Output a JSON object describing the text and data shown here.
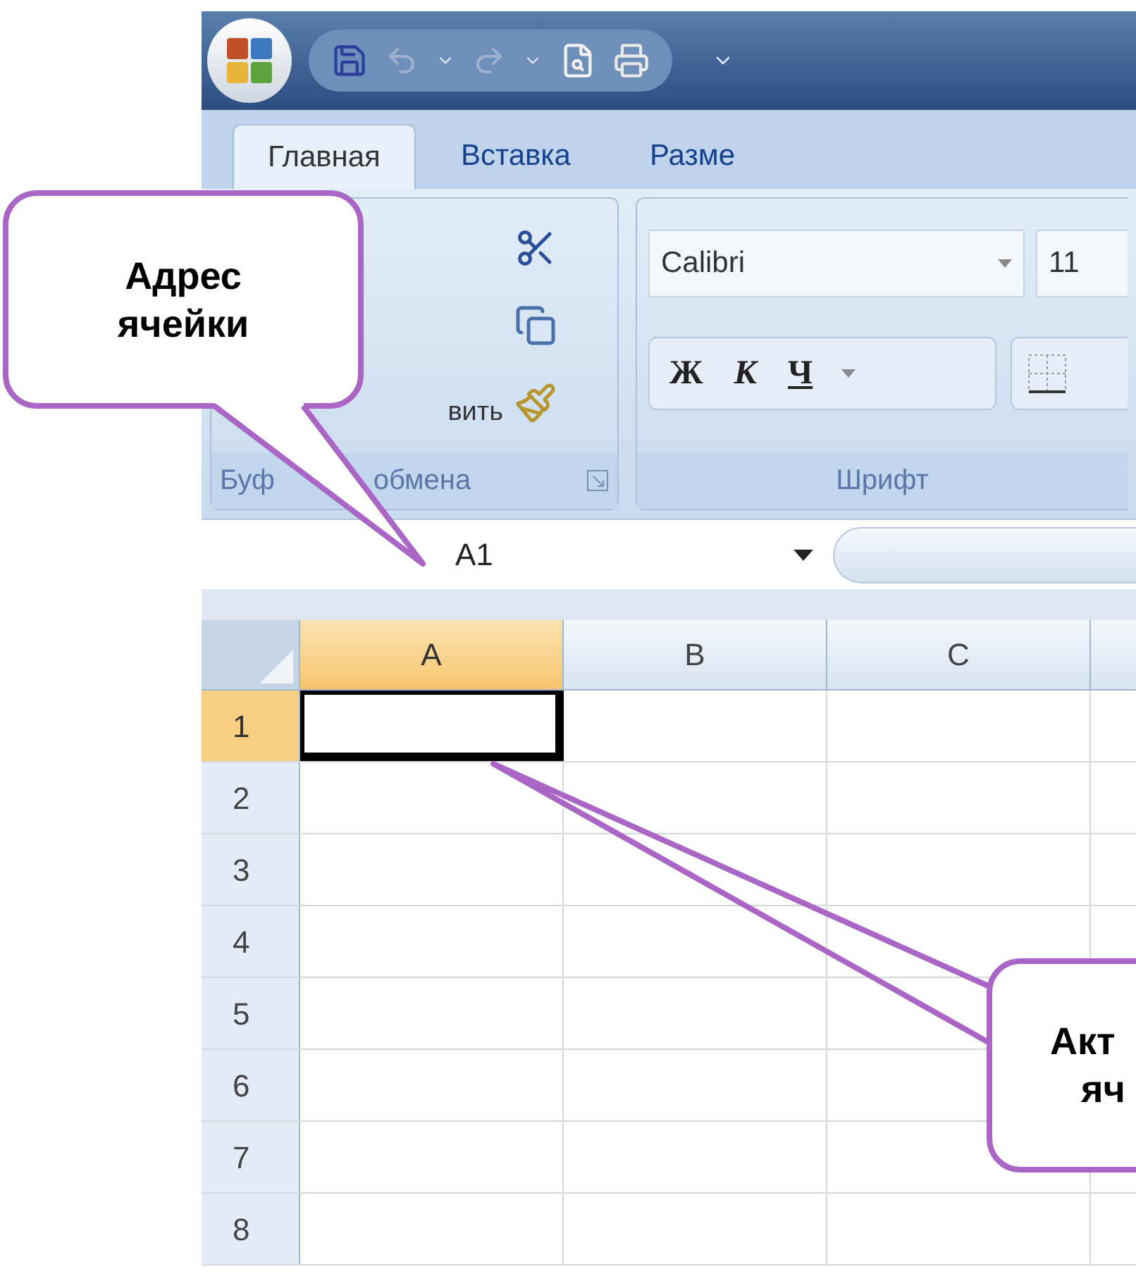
{
  "tabs": [
    {
      "label": "Главная",
      "selected": true
    },
    {
      "label": "Вставка",
      "selected": false
    },
    {
      "label": "Разме",
      "selected": false
    }
  ],
  "ribbon": {
    "clipboard": {
      "paste_label": "вить",
      "group_label_parts": [
        "Буф",
        "обмена"
      ]
    },
    "font": {
      "font_name": "Calibri",
      "font_size": "11",
      "style_buttons": [
        {
          "label": "Ж",
          "kind": "bold"
        },
        {
          "label": "К",
          "kind": "italic"
        },
        {
          "label": "Ч",
          "kind": "underline"
        }
      ],
      "group_label": "Шрифт"
    }
  },
  "name_box": {
    "value": "A1"
  },
  "sheet": {
    "columns": [
      {
        "label": "A",
        "selected": true
      },
      {
        "label": "B",
        "selected": false
      },
      {
        "label": "C",
        "selected": false
      }
    ],
    "rows": [
      {
        "label": "1",
        "selected": true
      },
      {
        "label": "2",
        "selected": false
      },
      {
        "label": "3",
        "selected": false
      },
      {
        "label": "4",
        "selected": false
      },
      {
        "label": "5",
        "selected": false
      },
      {
        "label": "6",
        "selected": false
      },
      {
        "label": "7",
        "selected": false
      },
      {
        "label": "8",
        "selected": false
      }
    ]
  },
  "callouts": [
    {
      "lines": [
        "Адрес",
        "ячейки"
      ]
    },
    {
      "lines": [
        "Акт",
        "яч"
      ]
    }
  ]
}
